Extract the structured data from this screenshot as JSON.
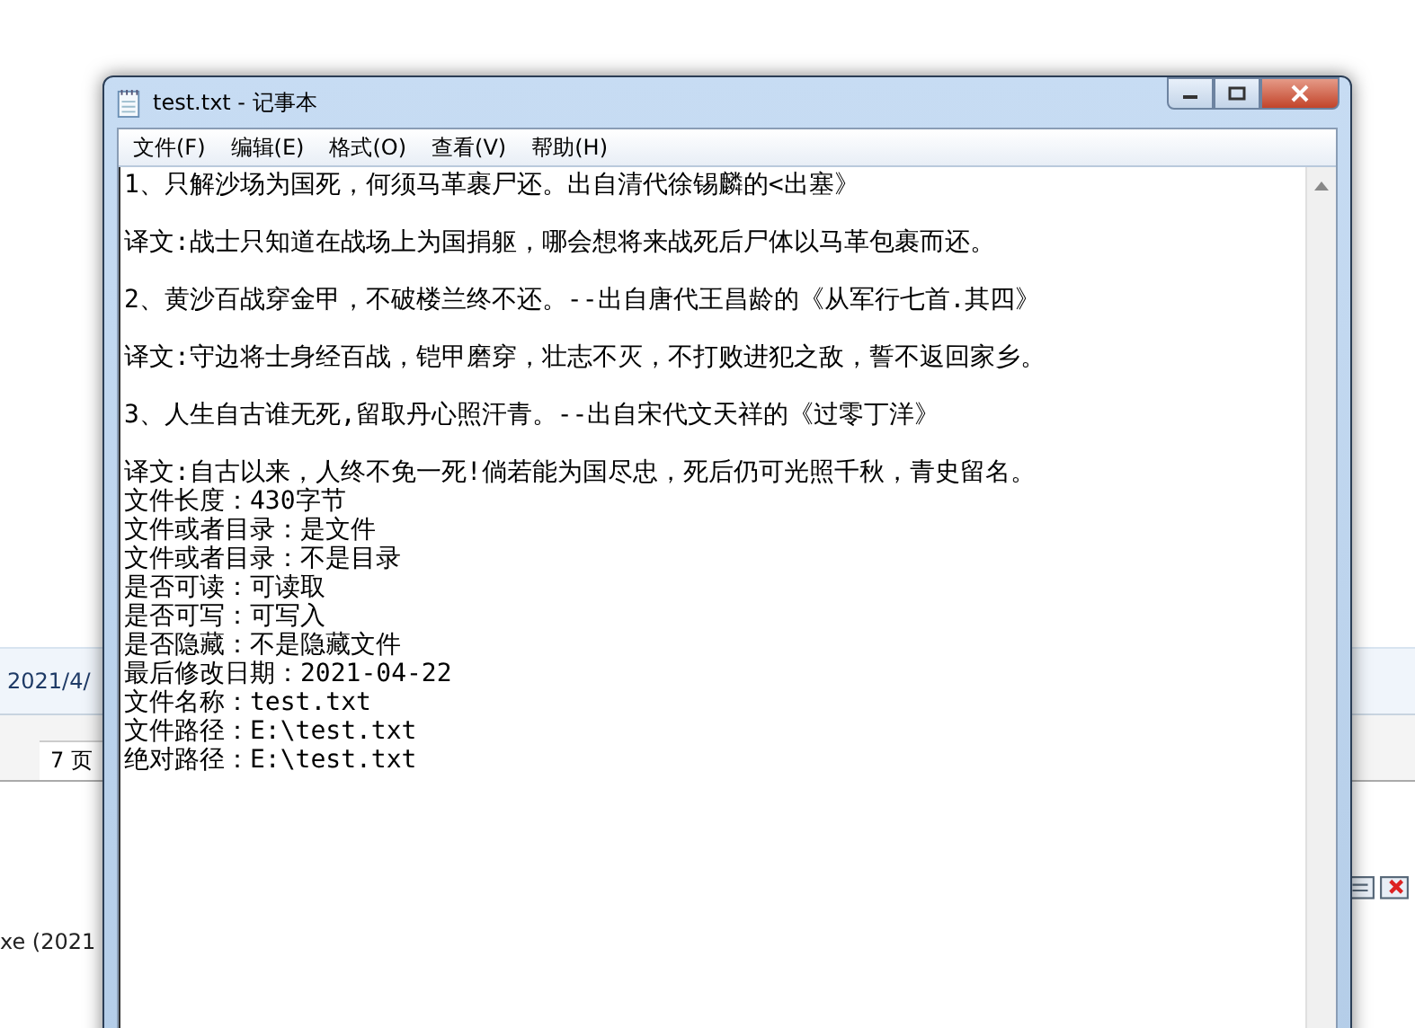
{
  "background_app": {
    "date_text": "2021/4/",
    "page_count": "7 页",
    "list_item": "xe (2021"
  },
  "window": {
    "title": "test.txt - 记事本"
  },
  "menu": [
    "文件(F)",
    "编辑(E)",
    "格式(O)",
    "查看(V)",
    "帮助(H)"
  ],
  "document": {
    "paragraphs": [
      [
        "1、只解沙场为国死，何须马革裹尸还。出自清代徐锡麟的<出塞》"
      ],
      [
        "译文:战士只知道在战场上为国捐躯，哪会想将来战死后尸体以马革包裹而还。"
      ],
      [
        "2、黄沙百战穿金甲，不破楼兰终不还。--出自唐代王昌龄的《从军行七首.其四》"
      ],
      [
        "译文:守边将士身经百战，铠甲磨穿，壮志不灭，不打败进犯之敌，誓不返回家乡。"
      ],
      [
        "3、人生自古谁无死,留取丹心照汗青。--出自宋代文天祥的《过零丁洋》"
      ],
      [
        "译文:自古以来，人终不免一死!倘若能为国尽忠，死后仍可光照千秋，青史留名。",
        "文件长度：430字节",
        "文件或者目录：是文件",
        "文件或者目录：不是目录",
        "是否可读：可读取",
        "是否可写：可写入",
        "是否隐藏：不是隐藏文件",
        "最后修改日期：2021-04-22",
        "文件名称：test.txt",
        "文件路径：E:\\test.txt",
        "绝对路径：E:\\test.txt"
      ]
    ]
  }
}
